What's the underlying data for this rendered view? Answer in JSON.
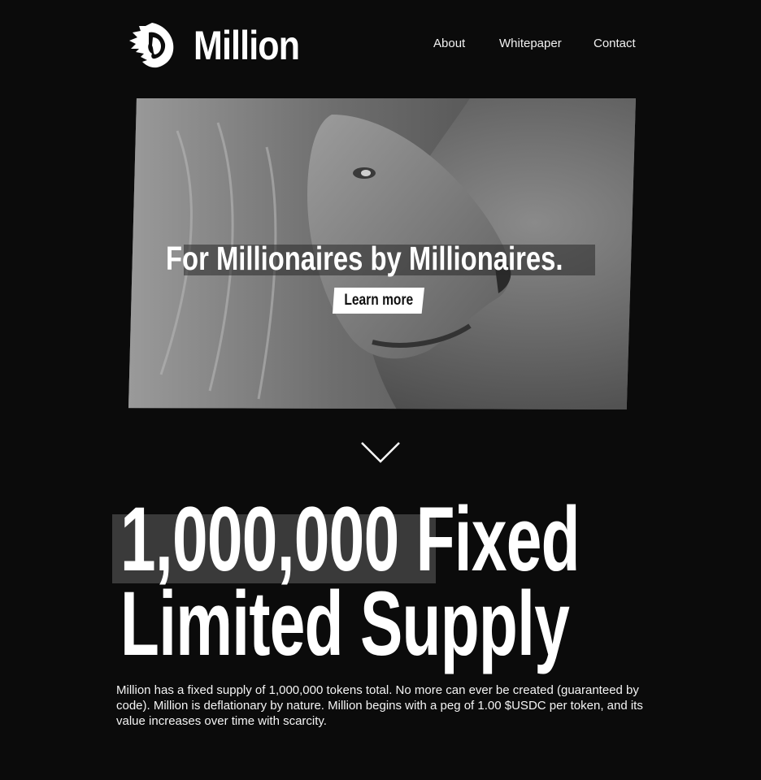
{
  "header": {
    "brand": "Million",
    "logo_icon": "lion-head-icon",
    "nav": [
      "About",
      "Whitepaper",
      "Contact"
    ]
  },
  "hero": {
    "image": "lion-portrait-grayscale",
    "tagline": "For Millionaires by Millionaires.",
    "cta_label": "Learn more"
  },
  "scroll_icon": "chevron-down-icon",
  "supply": {
    "headline_line1": "1,000,000 Fixed",
    "headline_line2": "Limited Supply",
    "description": "Million has a fixed supply of 1,000,000 tokens total. No more can ever be created (guaranteed by code). Million is deflationary by nature. Million begins with a peg of 1.00 $USDC per token, and its value increases over time with scarcity."
  },
  "colors": {
    "background": "#0b0b0b",
    "text": "#ffffff",
    "highlight": "#3a3a3a"
  }
}
